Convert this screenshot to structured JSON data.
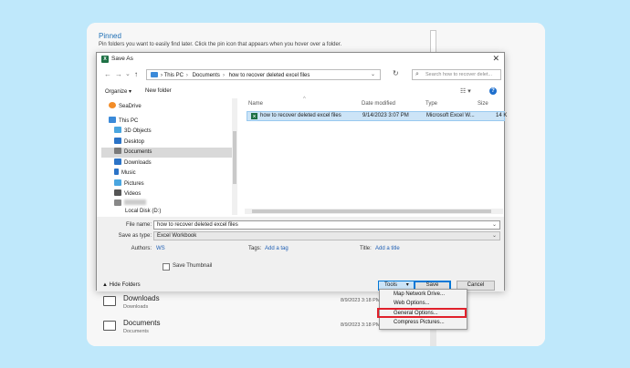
{
  "background": {
    "pinned_title": "Pinned",
    "pinned_desc": "Pin folders you want to easily find later. Click the pin icon that appears when you hover over a folder.",
    "rows": [
      {
        "name": "Downloads",
        "sub": "Downloads",
        "date": "8/9/2023 3:18 PM"
      },
      {
        "name": "Documents",
        "sub": "Documents",
        "date": "8/9/2023 3:18 PM"
      }
    ]
  },
  "dialog": {
    "title": "Save As",
    "close": "✕",
    "nav": {
      "back": "←",
      "forward": "→",
      "down": "⌄",
      "up": "↑",
      "refresh": "↻"
    },
    "address": [
      "This PC",
      "Documents",
      "how to recover deleted excel files"
    ],
    "address_sep": "›",
    "address_drop": "⌄",
    "search_placeholder": "Search how to recover delet...",
    "toolbar": {
      "organize": "Organize ▾",
      "new_folder": "New folder",
      "view": "☷ ▾",
      "help": "?"
    },
    "nav_items": [
      {
        "label": "SeaDrive",
        "icon_color": "#f28c28"
      },
      {
        "label": "This PC",
        "icon_color": "#3b8ad9"
      },
      {
        "label": "3D Objects",
        "icon_color": "#4aa6e0"
      },
      {
        "label": "Desktop",
        "icon_color": "#2b73c7"
      },
      {
        "label": "Documents",
        "icon_color": "#7a7a7a"
      },
      {
        "label": "Downloads",
        "icon_color": "#2b73c7"
      },
      {
        "label": "Music",
        "icon_color": "#2b73c7"
      },
      {
        "label": "Pictures",
        "icon_color": "#4aa6e0"
      },
      {
        "label": "Videos",
        "icon_color": "#555555"
      },
      {
        "label": "Local Disk (D:)",
        "icon_color": "#888888"
      }
    ],
    "columns": [
      "Name",
      "Date modified",
      "Type",
      "Size"
    ],
    "sort_arrow": "^",
    "file": {
      "name": "how to recover deleted excel files",
      "date": "9/14/2023 3:07 PM",
      "type": "Microsoft Excel W...",
      "size": "14 K",
      "icon": "X"
    },
    "fields": {
      "file_name_label": "File name:",
      "file_name_value": "how to recover deleted excel files",
      "save_type_label": "Save as type:",
      "save_type_value": "Excel Workbook",
      "drop": "⌄",
      "authors_label": "Authors:",
      "authors_value": "WS",
      "tags_label": "Tags:",
      "tags_value": "Add a tag",
      "title_label": "Title:",
      "title_value": "Add a title",
      "thumbnail_label": "Save Thumbnail"
    },
    "hide_folders": "▲ Hide Folders",
    "buttons": {
      "tools": "Tools",
      "tools_arrow": "▾",
      "save": "Save",
      "cancel": "Cancel"
    }
  },
  "tools_menu": [
    "Map Network Drive...",
    "Web Options...",
    "General Options...",
    "Compress Pictures..."
  ]
}
